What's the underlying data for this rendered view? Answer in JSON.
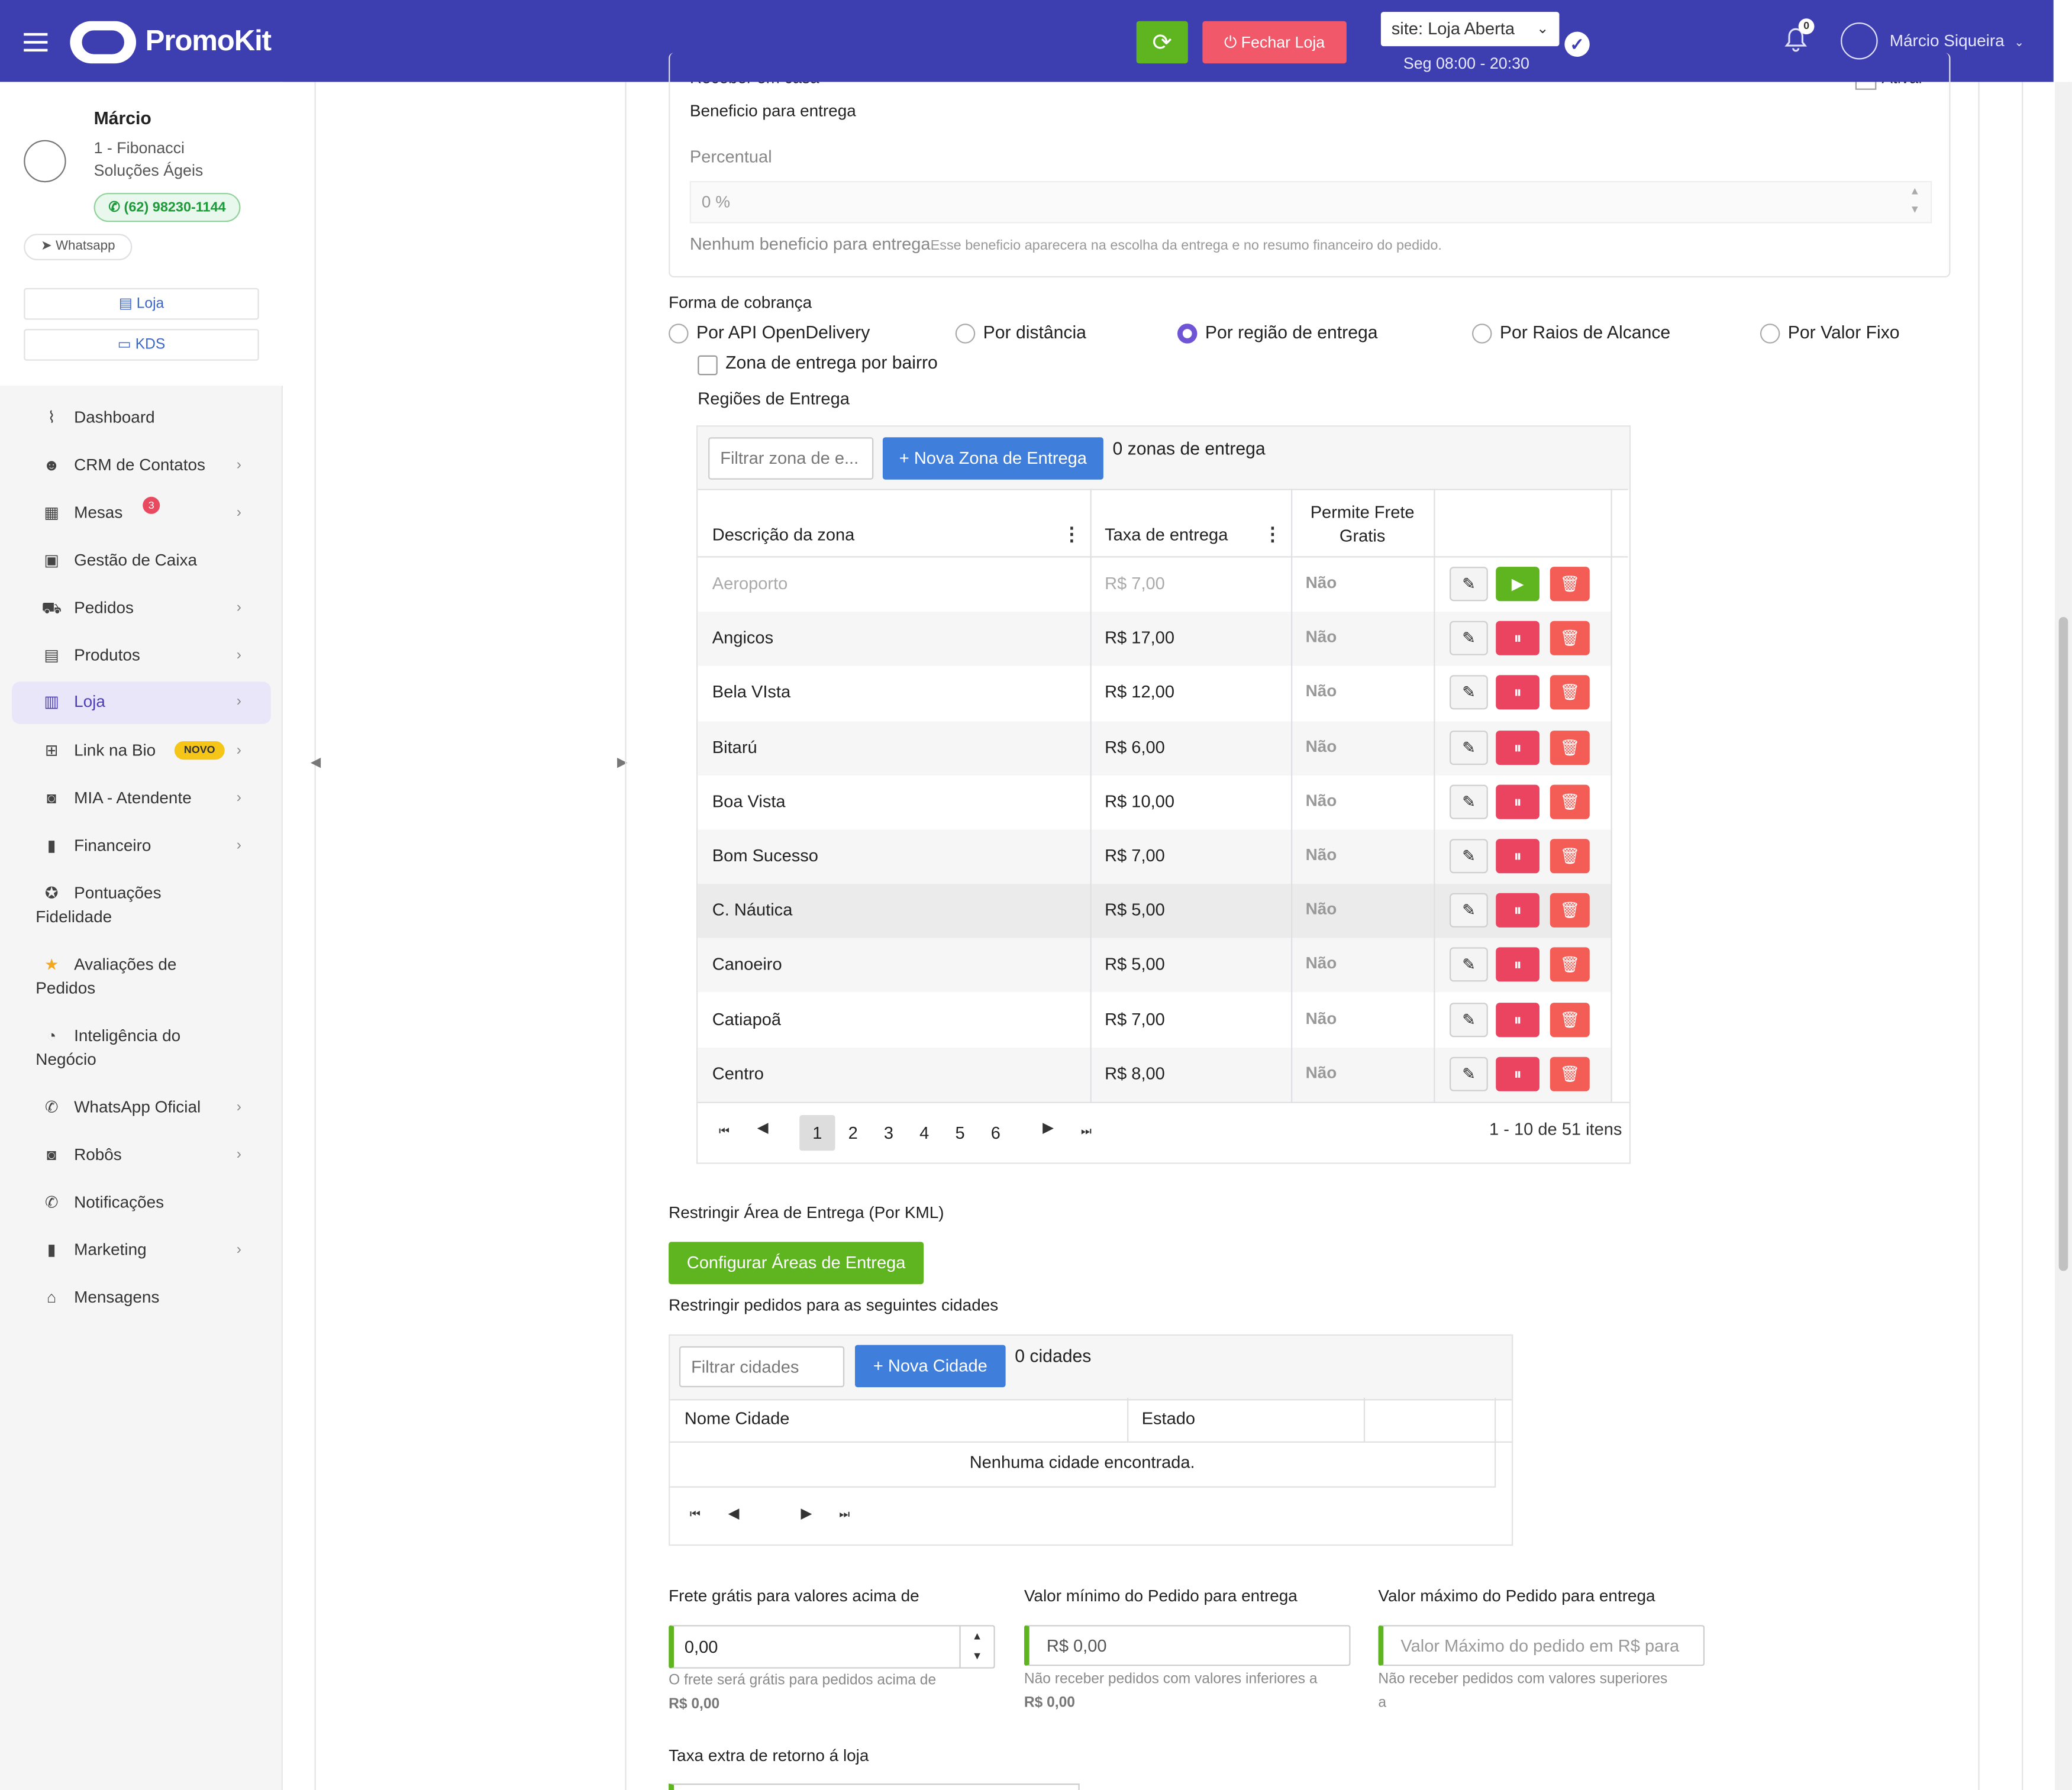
{
  "topbar": {
    "brand": "PromoKit",
    "refresh_icon": "refresh-icon",
    "close_store_label": "⏻ Fechar Loja",
    "site_status": "site: Loja Aberta",
    "hours": "Seg 08:00 - 20:30",
    "notifications_count": "0",
    "user_name": "Márcio Siqueira",
    "colors": {
      "bar": "#3d3fb0",
      "refresh": "#5eb520",
      "close": "#f1596a"
    }
  },
  "sidebar": {
    "user_first_name": "Márcio",
    "company_line1": "1 - Fibonacci",
    "company_line2": "Soluções Ágeis",
    "phone": "(62) 98230-1144",
    "whatsapp_tag": "Whatsapp",
    "store_button": "Loja",
    "kds_button": "KDS",
    "items": [
      {
        "label": "Dashboard",
        "icon": "chart-line-icon",
        "chevron": false
      },
      {
        "label": "CRM de Contatos",
        "icon": "users-icon",
        "chevron": true
      },
      {
        "label": "Mesas",
        "icon": "table-icon",
        "chevron": true,
        "badge": "3"
      },
      {
        "label": "Gestão de Caixa",
        "icon": "cash-register-icon",
        "chevron": false
      },
      {
        "label": "Pedidos",
        "icon": "cart-icon",
        "chevron": true
      },
      {
        "label": "Produtos",
        "icon": "boxes-icon",
        "chevron": true
      },
      {
        "label": "Loja",
        "icon": "building-icon",
        "chevron": true,
        "active": true
      },
      {
        "label": "Link na Bio",
        "icon": "sitemap-icon",
        "chevron": true,
        "tag": "NOVO"
      },
      {
        "label": "MIA - Atendente",
        "icon": "robot-icon",
        "chevron": true
      },
      {
        "label": "Financeiro",
        "icon": "bar-chart-icon",
        "chevron": true
      },
      {
        "label": "Pontuações",
        "label2": "Fidelidade",
        "icon": "medal-icon",
        "chevron": false
      },
      {
        "label": "Avaliações de",
        "label2": "Pedidos",
        "icon": "star-icon",
        "chevron": false
      },
      {
        "label": "Inteligência do",
        "label2": "Negócio",
        "icon": "pie-chart-icon",
        "chevron": false
      },
      {
        "label": "WhatsApp Oficial",
        "icon": "whatsapp-icon",
        "chevron": true
      },
      {
        "label": "Robôs",
        "icon": "robot-icon",
        "chevron": true
      },
      {
        "label": "Notificações",
        "icon": "whatsapp-icon",
        "chevron": false
      },
      {
        "label": "Marketing",
        "icon": "bar-chart-icon",
        "chevron": true
      },
      {
        "label": "Mensagens",
        "icon": "inbox-icon",
        "chevron": false
      }
    ]
  },
  "benefit": {
    "cut_label": "Receber em casa",
    "cut_checkbox_label": "Ativar",
    "title": "Beneficio para entrega",
    "percent_label": "Percentual",
    "percent_value": "0 %",
    "none_label": "Nenhum beneficio para entrega",
    "none_hint": "Esse beneficio aparecera na escolha da entrega e no resumo financeiro do pedido."
  },
  "billing": {
    "label": "Forma de cobrança",
    "options": [
      "Por API OpenDelivery",
      "Por distância",
      "Por região de entrega",
      "Por Raios de Alcance",
      "Por Valor Fixo"
    ],
    "selected": "Por região de entrega",
    "zone_by_neighborhood": "Zona de entrega por bairro",
    "regions_title": "Regiões de Entrega"
  },
  "zones": {
    "filter_placeholder": "Filtrar zona de e...",
    "new_button": "+ Nova Zona de Entrega",
    "count_label": "0 zonas de entrega",
    "headers": {
      "desc": "Descrição da zona",
      "fee": "Taxa de entrega",
      "free1": "Permite Frete",
      "free2": "Gratis"
    },
    "rows": [
      {
        "desc": "Aeroporto",
        "fee": "R$ 7,00",
        "free": "Não",
        "paused": true
      },
      {
        "desc": "Angicos",
        "fee": "R$ 17,00",
        "free": "Não"
      },
      {
        "desc": "Bela VIsta",
        "fee": "R$ 12,00",
        "free": "Não"
      },
      {
        "desc": "Bitarú",
        "fee": "R$ 6,00",
        "free": "Não"
      },
      {
        "desc": "Boa Vista",
        "fee": "R$ 10,00",
        "free": "Não"
      },
      {
        "desc": "Bom Sucesso",
        "fee": "R$ 7,00",
        "free": "Não"
      },
      {
        "desc": "C. Náutica",
        "fee": "R$ 5,00",
        "free": "Não"
      },
      {
        "desc": "Canoeiro",
        "fee": "R$ 5,00",
        "free": "Não"
      },
      {
        "desc": "Catiapoã",
        "fee": "R$ 7,00",
        "free": "Não"
      },
      {
        "desc": "Centro",
        "fee": "R$ 8,00",
        "free": "Não"
      }
    ],
    "pages": [
      "1",
      "2",
      "3",
      "4",
      "5",
      "6"
    ],
    "current_page": "1",
    "summary": "1 - 10 de 51 itens"
  },
  "kml": {
    "title": "Restringir Área de Entrega (Por KML)",
    "button": "Configurar Áreas de Entrega"
  },
  "cities": {
    "title": "Restringir pedidos para as seguintes cidades",
    "filter_placeholder": "Filtrar cidades",
    "new_button": "+ Nova Cidade",
    "count_label": "0 cidades",
    "col_city": "Nome Cidade",
    "col_state": "Estado",
    "empty": "Nenhuma cidade encontrada."
  },
  "limits": {
    "free_label": "Frete grátis para valores acima de",
    "free_value": "0,00",
    "free_hint": "O frete será grátis para pedidos acima de",
    "free_hint_value": "R$ 0,00",
    "min_label": "Valor mínimo do Pedido para entrega",
    "min_value": "R$ 0,00",
    "min_hint": "Não receber pedidos com valores inferiores a",
    "min_hint_value": "R$ 0,00",
    "max_label": "Valor máximo do Pedido para entrega",
    "max_placeholder": "Valor Máximo do pedido em R$ para",
    "max_hint": "Não receber pedidos com valores superiores",
    "max_hint2": "a",
    "return_fee_label": "Taxa extra de retorno á loja"
  }
}
